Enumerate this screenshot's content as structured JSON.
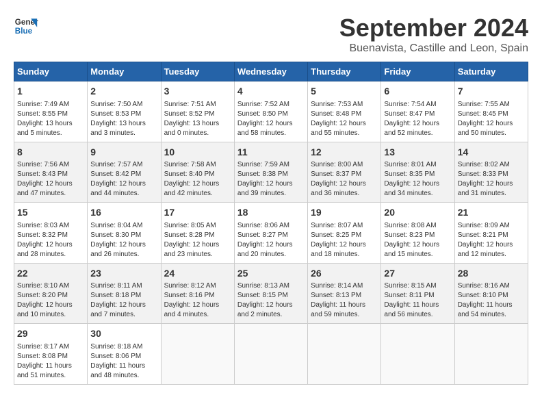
{
  "header": {
    "logo_line1": "General",
    "logo_line2": "Blue",
    "title": "September 2024",
    "subtitle": "Buenavista, Castille and Leon, Spain"
  },
  "columns": [
    "Sunday",
    "Monday",
    "Tuesday",
    "Wednesday",
    "Thursday",
    "Friday",
    "Saturday"
  ],
  "weeks": [
    [
      {
        "day": "1",
        "lines": [
          "Sunrise: 7:49 AM",
          "Sunset: 8:55 PM",
          "Daylight: 13 hours",
          "and 5 minutes."
        ]
      },
      {
        "day": "2",
        "lines": [
          "Sunrise: 7:50 AM",
          "Sunset: 8:53 PM",
          "Daylight: 13 hours",
          "and 3 minutes."
        ]
      },
      {
        "day": "3",
        "lines": [
          "Sunrise: 7:51 AM",
          "Sunset: 8:52 PM",
          "Daylight: 13 hours",
          "and 0 minutes."
        ]
      },
      {
        "day": "4",
        "lines": [
          "Sunrise: 7:52 AM",
          "Sunset: 8:50 PM",
          "Daylight: 12 hours",
          "and 58 minutes."
        ]
      },
      {
        "day": "5",
        "lines": [
          "Sunrise: 7:53 AM",
          "Sunset: 8:48 PM",
          "Daylight: 12 hours",
          "and 55 minutes."
        ]
      },
      {
        "day": "6",
        "lines": [
          "Sunrise: 7:54 AM",
          "Sunset: 8:47 PM",
          "Daylight: 12 hours",
          "and 52 minutes."
        ]
      },
      {
        "day": "7",
        "lines": [
          "Sunrise: 7:55 AM",
          "Sunset: 8:45 PM",
          "Daylight: 12 hours",
          "and 50 minutes."
        ]
      }
    ],
    [
      {
        "day": "8",
        "lines": [
          "Sunrise: 7:56 AM",
          "Sunset: 8:43 PM",
          "Daylight: 12 hours",
          "and 47 minutes."
        ]
      },
      {
        "day": "9",
        "lines": [
          "Sunrise: 7:57 AM",
          "Sunset: 8:42 PM",
          "Daylight: 12 hours",
          "and 44 minutes."
        ]
      },
      {
        "day": "10",
        "lines": [
          "Sunrise: 7:58 AM",
          "Sunset: 8:40 PM",
          "Daylight: 12 hours",
          "and 42 minutes."
        ]
      },
      {
        "day": "11",
        "lines": [
          "Sunrise: 7:59 AM",
          "Sunset: 8:38 PM",
          "Daylight: 12 hours",
          "and 39 minutes."
        ]
      },
      {
        "day": "12",
        "lines": [
          "Sunrise: 8:00 AM",
          "Sunset: 8:37 PM",
          "Daylight: 12 hours",
          "and 36 minutes."
        ]
      },
      {
        "day": "13",
        "lines": [
          "Sunrise: 8:01 AM",
          "Sunset: 8:35 PM",
          "Daylight: 12 hours",
          "and 34 minutes."
        ]
      },
      {
        "day": "14",
        "lines": [
          "Sunrise: 8:02 AM",
          "Sunset: 8:33 PM",
          "Daylight: 12 hours",
          "and 31 minutes."
        ]
      }
    ],
    [
      {
        "day": "15",
        "lines": [
          "Sunrise: 8:03 AM",
          "Sunset: 8:32 PM",
          "Daylight: 12 hours",
          "and 28 minutes."
        ]
      },
      {
        "day": "16",
        "lines": [
          "Sunrise: 8:04 AM",
          "Sunset: 8:30 PM",
          "Daylight: 12 hours",
          "and 26 minutes."
        ]
      },
      {
        "day": "17",
        "lines": [
          "Sunrise: 8:05 AM",
          "Sunset: 8:28 PM",
          "Daylight: 12 hours",
          "and 23 minutes."
        ]
      },
      {
        "day": "18",
        "lines": [
          "Sunrise: 8:06 AM",
          "Sunset: 8:27 PM",
          "Daylight: 12 hours",
          "and 20 minutes."
        ]
      },
      {
        "day": "19",
        "lines": [
          "Sunrise: 8:07 AM",
          "Sunset: 8:25 PM",
          "Daylight: 12 hours",
          "and 18 minutes."
        ]
      },
      {
        "day": "20",
        "lines": [
          "Sunrise: 8:08 AM",
          "Sunset: 8:23 PM",
          "Daylight: 12 hours",
          "and 15 minutes."
        ]
      },
      {
        "day": "21",
        "lines": [
          "Sunrise: 8:09 AM",
          "Sunset: 8:21 PM",
          "Daylight: 12 hours",
          "and 12 minutes."
        ]
      }
    ],
    [
      {
        "day": "22",
        "lines": [
          "Sunrise: 8:10 AM",
          "Sunset: 8:20 PM",
          "Daylight: 12 hours",
          "and 10 minutes."
        ]
      },
      {
        "day": "23",
        "lines": [
          "Sunrise: 8:11 AM",
          "Sunset: 8:18 PM",
          "Daylight: 12 hours",
          "and 7 minutes."
        ]
      },
      {
        "day": "24",
        "lines": [
          "Sunrise: 8:12 AM",
          "Sunset: 8:16 PM",
          "Daylight: 12 hours",
          "and 4 minutes."
        ]
      },
      {
        "day": "25",
        "lines": [
          "Sunrise: 8:13 AM",
          "Sunset: 8:15 PM",
          "Daylight: 12 hours",
          "and 2 minutes."
        ]
      },
      {
        "day": "26",
        "lines": [
          "Sunrise: 8:14 AM",
          "Sunset: 8:13 PM",
          "Daylight: 11 hours",
          "and 59 minutes."
        ]
      },
      {
        "day": "27",
        "lines": [
          "Sunrise: 8:15 AM",
          "Sunset: 8:11 PM",
          "Daylight: 11 hours",
          "and 56 minutes."
        ]
      },
      {
        "day": "28",
        "lines": [
          "Sunrise: 8:16 AM",
          "Sunset: 8:10 PM",
          "Daylight: 11 hours",
          "and 54 minutes."
        ]
      }
    ],
    [
      {
        "day": "29",
        "lines": [
          "Sunrise: 8:17 AM",
          "Sunset: 8:08 PM",
          "Daylight: 11 hours",
          "and 51 minutes."
        ]
      },
      {
        "day": "30",
        "lines": [
          "Sunrise: 8:18 AM",
          "Sunset: 8:06 PM",
          "Daylight: 11 hours",
          "and 48 minutes."
        ]
      },
      null,
      null,
      null,
      null,
      null
    ]
  ]
}
